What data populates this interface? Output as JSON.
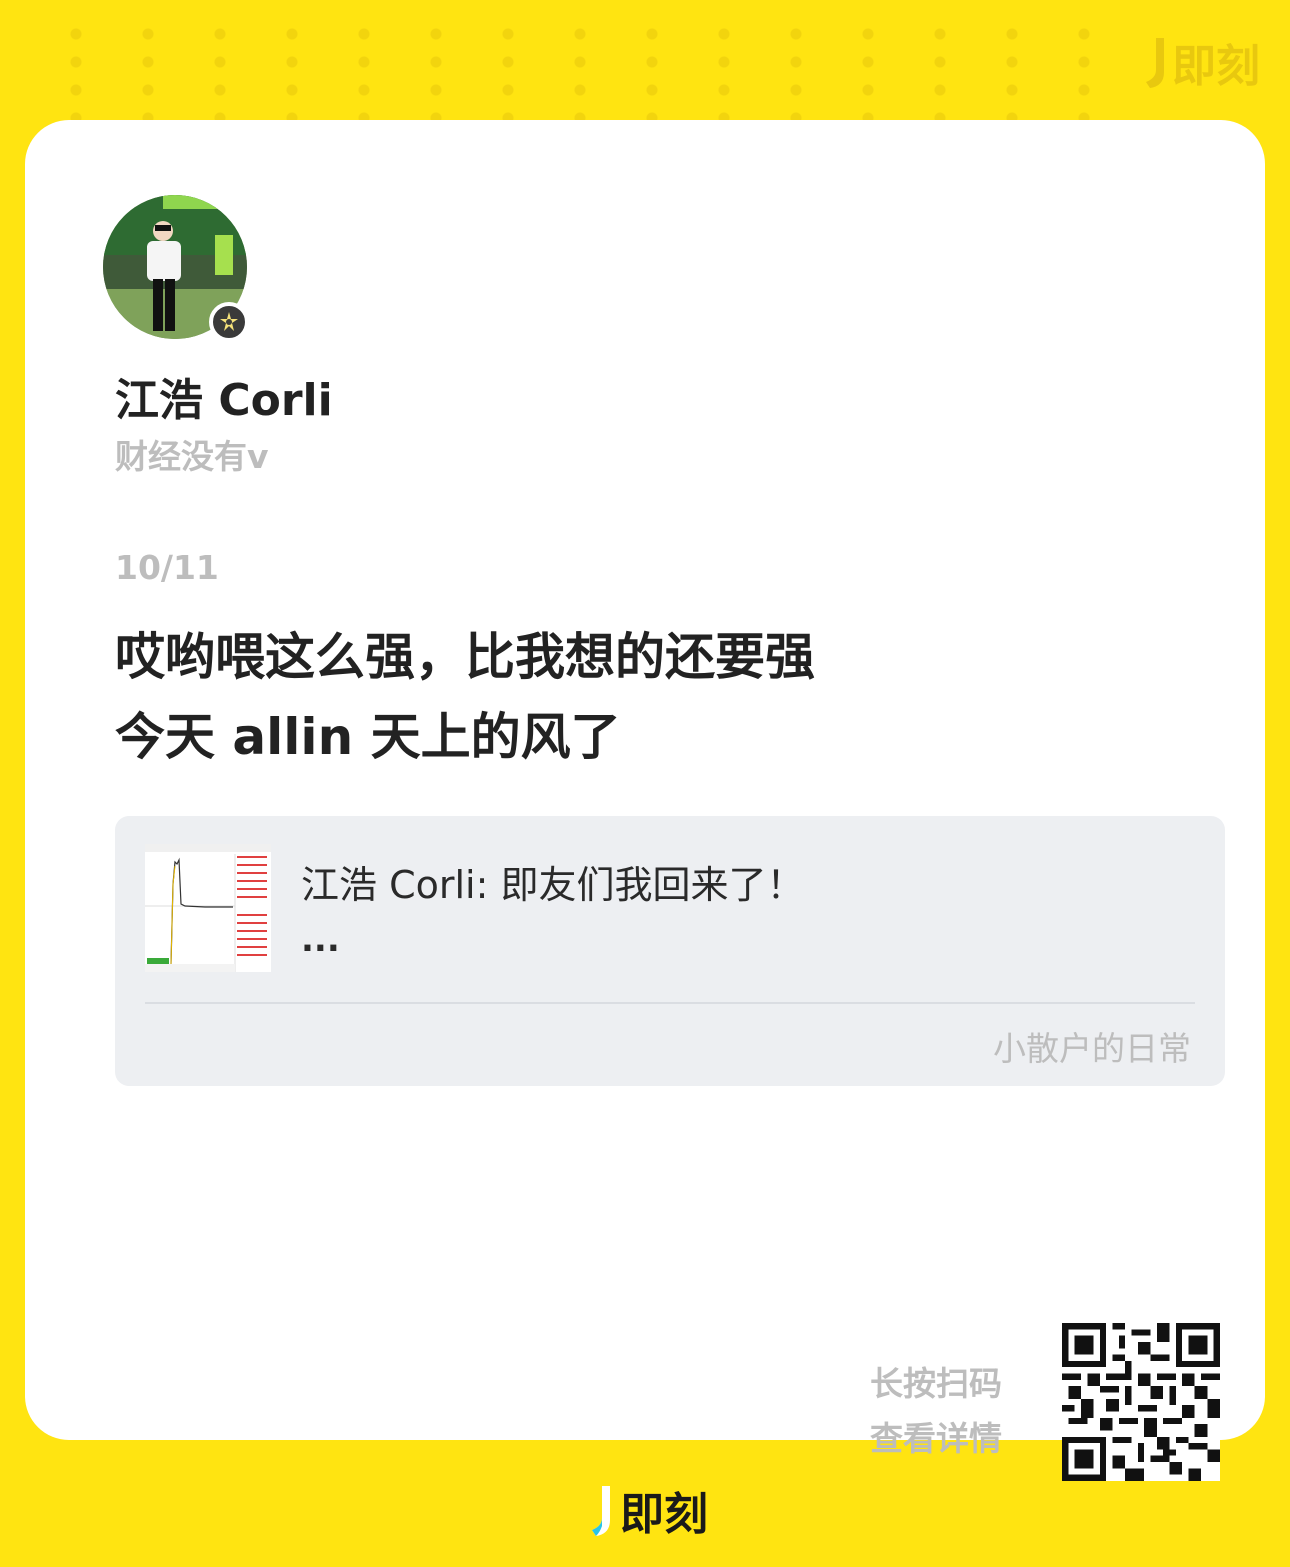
{
  "brand": {
    "name": "即刻",
    "icon": "jike-logo-icon",
    "bg_color": "#FFE411"
  },
  "author": {
    "name": "江浩 Corli",
    "bio": "财经没有v",
    "avatar_icon": "user-avatar",
    "badge_icon": "verified-badge-icon"
  },
  "post": {
    "date": "10/11",
    "lines": [
      "哎哟喂这么强，比我想的还要强",
      "今天 allin 天上的风了"
    ]
  },
  "repost": {
    "text": "江浩 Corli: 即友们我回来了！",
    "ellipsis": "...",
    "topic": "小散户的日常",
    "thumb_icon": "stock-chart-thumbnail"
  },
  "qr_hint": {
    "line1": "长按扫码",
    "line2": "查看详情"
  }
}
